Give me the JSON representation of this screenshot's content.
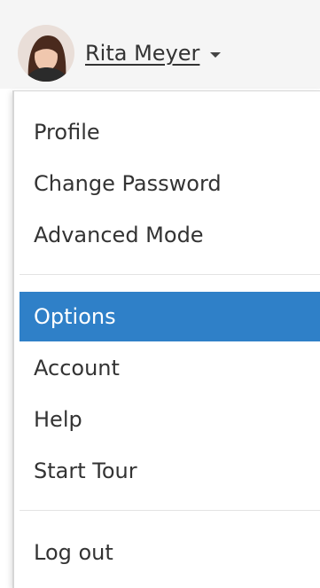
{
  "user": {
    "name": "Rita Meyer"
  },
  "menu": {
    "items": [
      {
        "label": "Profile"
      },
      {
        "label": "Change Password"
      },
      {
        "label": "Advanced Mode"
      },
      {
        "label": "Options",
        "active": true
      },
      {
        "label": "Account"
      },
      {
        "label": "Help"
      },
      {
        "label": "Start Tour"
      },
      {
        "label": "Log out"
      }
    ]
  },
  "colors": {
    "active_background": "#2f80c8",
    "active_text": "#ffffff",
    "text": "#333333"
  }
}
